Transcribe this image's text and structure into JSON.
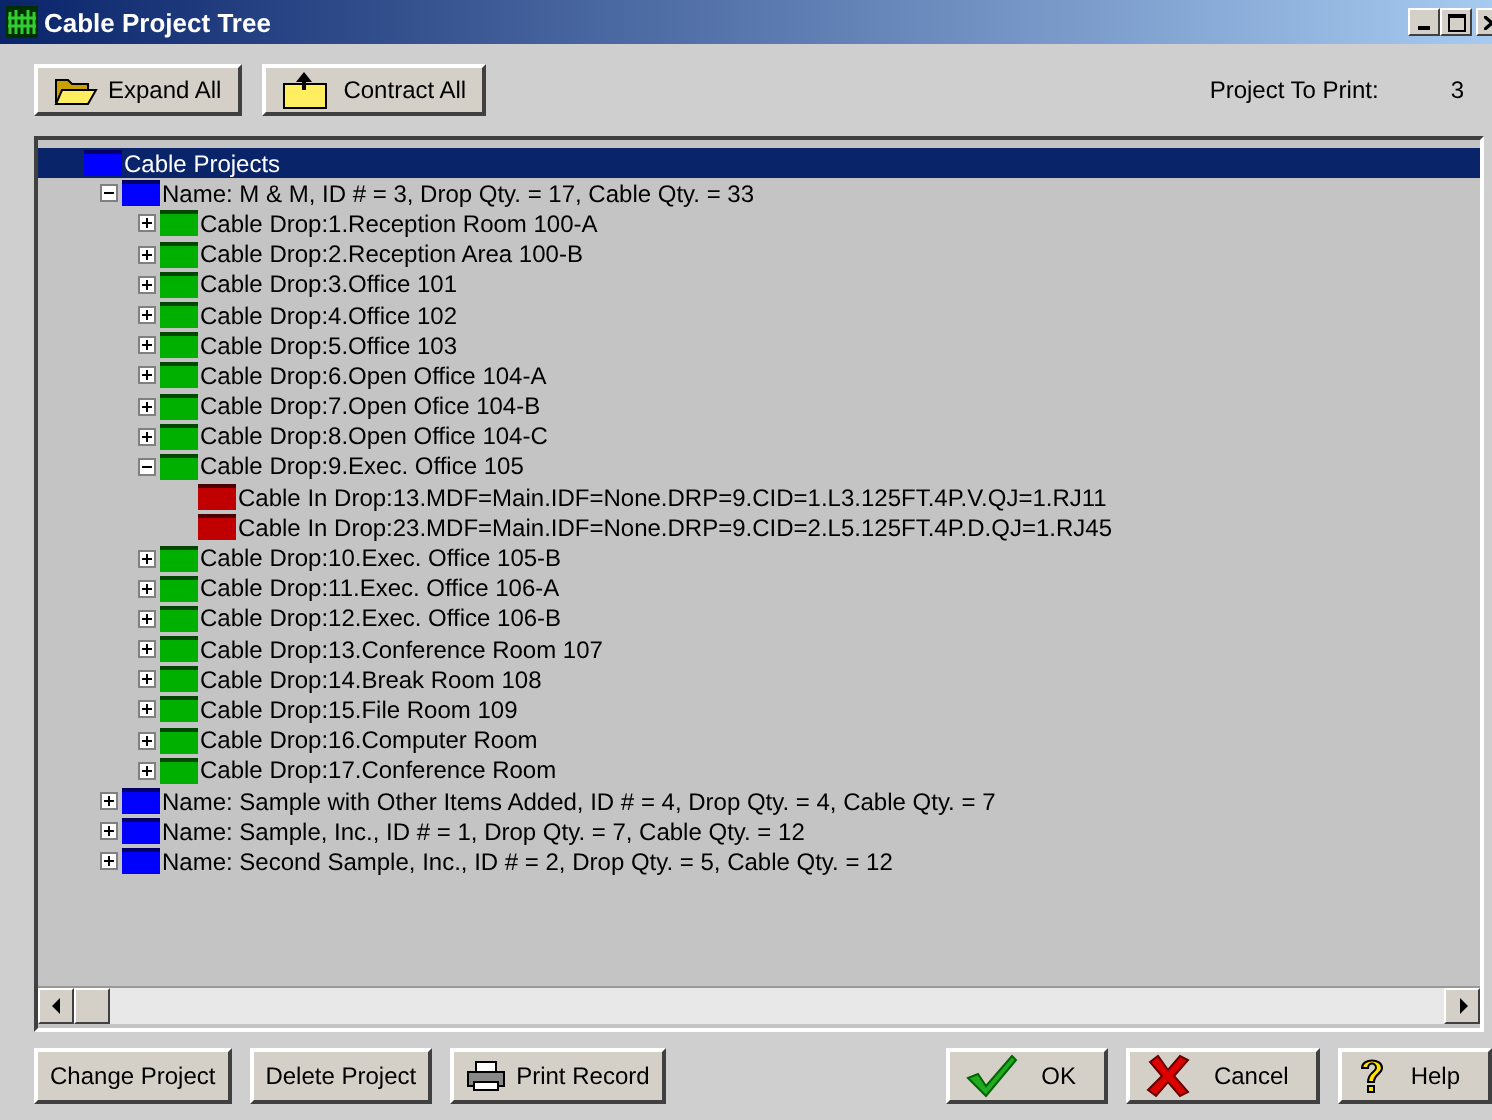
{
  "window": {
    "title": "Cable Project Tree"
  },
  "toolbar": {
    "buttons": [
      {
        "label": "Expand All",
        "kind": "expand"
      },
      {
        "label": "Contract All",
        "kind": "contract"
      }
    ],
    "project_label": "Project To Print:",
    "project_value": "3"
  },
  "tree": {
    "label": "Cable Projects",
    "kind": "root",
    "selected": true,
    "children": [
      {
        "label": "Name: M & M, ID # = 3, Drop Qty. = 17, Cable Qty. = 33",
        "kind": "project",
        "expanded": true,
        "selected": false,
        "children": [
          {
            "label": "Cable Drop:1.Reception Room 100-A",
            "kind": "drop",
            "expanded": false,
            "selected": false
          },
          {
            "label": "Cable Drop:2.Reception Area 100-B",
            "kind": "drop",
            "expanded": false,
            "selected": false
          },
          {
            "label": "Cable Drop:3.Office 101",
            "kind": "drop",
            "expanded": false,
            "selected": false
          },
          {
            "label": "Cable Drop:4.Office 102",
            "kind": "drop",
            "expanded": false,
            "selected": false
          },
          {
            "label": "Cable Drop:5.Office 103",
            "kind": "drop",
            "expanded": false,
            "selected": false
          },
          {
            "label": "Cable Drop:6.Open Office 104-A",
            "kind": "drop",
            "expanded": false,
            "selected": false
          },
          {
            "label": "Cable Drop:7.Open Ofice 104-B",
            "kind": "drop",
            "expanded": false,
            "selected": false
          },
          {
            "label": "Cable Drop:8.Open Office 104-C",
            "kind": "drop",
            "expanded": false,
            "selected": false
          },
          {
            "label": "Cable Drop:9.Exec. Office 105",
            "kind": "drop",
            "expanded": true,
            "selected": false,
            "children": [
              {
                "label": "Cable In Drop:13.MDF=Main.IDF=None.DRP=9.CID=1.L3.125FT.4P.V.QJ=1.RJ11",
                "kind": "cable",
                "selected": false
              },
              {
                "label": "Cable In Drop:23.MDF=Main.IDF=None.DRP=9.CID=2.L5.125FT.4P.D.QJ=1.RJ45",
                "kind": "cable",
                "selected": false
              }
            ]
          },
          {
            "label": "Cable Drop:10.Exec. Office 105-B",
            "kind": "drop",
            "expanded": false,
            "selected": false
          },
          {
            "label": "Cable Drop:11.Exec. Office 106-A",
            "kind": "drop",
            "expanded": false,
            "selected": false
          },
          {
            "label": "Cable Drop:12.Exec. Office 106-B",
            "kind": "drop",
            "expanded": false,
            "selected": false
          },
          {
            "label": "Cable Drop:13.Conference Room 107",
            "kind": "drop",
            "expanded": false,
            "selected": false
          },
          {
            "label": "Cable Drop:14.Break Room 108",
            "kind": "drop",
            "expanded": false,
            "selected": false
          },
          {
            "label": "Cable Drop:15.File Room 109",
            "kind": "drop",
            "expanded": false,
            "selected": false
          },
          {
            "label": "Cable Drop:16.Computer Room",
            "kind": "drop",
            "expanded": false,
            "selected": false
          },
          {
            "label": "Cable Drop:17.Conference Room",
            "kind": "drop",
            "expanded": false,
            "selected": false
          }
        ]
      },
      {
        "label": "Name: Sample with Other Items Added, ID # = 4, Drop Qty. = 4, Cable Qty. = 7",
        "kind": "project",
        "expanded": false,
        "selected": false
      },
      {
        "label": "Name: Sample, Inc., ID # = 1, Drop Qty. = 7, Cable Qty. = 12",
        "kind": "project",
        "expanded": false,
        "selected": false
      },
      {
        "label": "Name: Second Sample, Inc., ID # = 2, Drop Qty. = 5, Cable Qty. = 12",
        "kind": "project",
        "expanded": false,
        "selected": false
      }
    ]
  },
  "footer": {
    "left_buttons": [
      {
        "label": "Change Project",
        "kind": "plain"
      },
      {
        "label": "Delete Project",
        "kind": "plain"
      },
      {
        "label": "Print Record",
        "kind": "print"
      }
    ],
    "right_buttons": [
      {
        "label": "OK",
        "kind": "ok"
      },
      {
        "label": "Cancel",
        "kind": "cancel"
      },
      {
        "label": "Help",
        "kind": "help"
      }
    ]
  }
}
